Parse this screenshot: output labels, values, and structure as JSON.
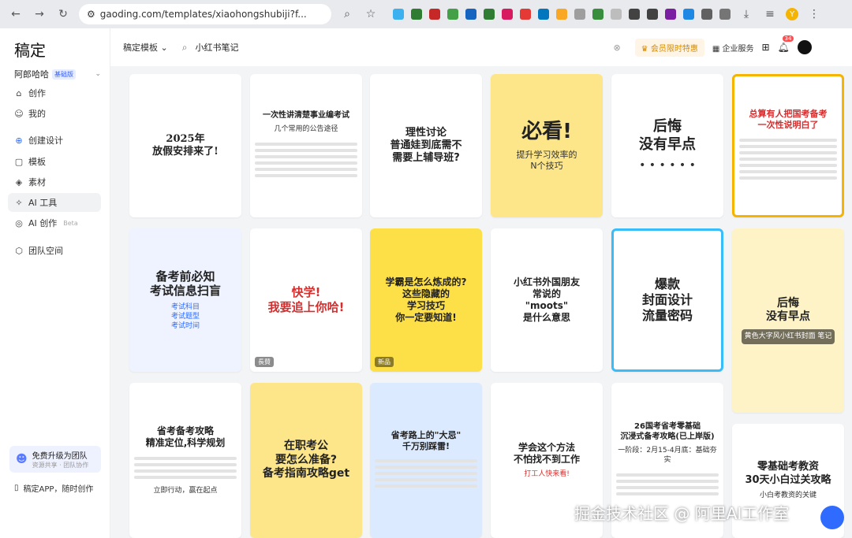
{
  "browser": {
    "url": "gaoding.com/templates/xiaohongshubiji?f...",
    "avatar_letter": "Y"
  },
  "sidebar": {
    "logo": "稿定",
    "user": "阿郎哈哈",
    "user_badge": "基础版",
    "items": [
      {
        "label": "创作",
        "icon": "home-icon"
      },
      {
        "label": "我的",
        "icon": "user-icon"
      },
      {
        "label": "创建设计",
        "icon": "plus-icon"
      },
      {
        "label": "模板",
        "icon": "template-icon"
      },
      {
        "label": "素材",
        "icon": "asset-icon"
      },
      {
        "label": "AI 工具",
        "icon": "ai-icon"
      },
      {
        "label": "AI 创作",
        "icon": "ai-create-icon",
        "badge": "Beta"
      },
      {
        "label": "团队空间",
        "icon": "team-icon"
      }
    ],
    "upgrade_title": "免费升级为团队",
    "upgrade_sub": "资源共享 · 团队协作",
    "app_label": "稿定APP，随时创作"
  },
  "topbar": {
    "template_select": "稿定模板",
    "search_value": "小红书笔记",
    "vip_label": "会员限时特惠",
    "biz_label": "企业服务",
    "notif_count": "34"
  },
  "cards": [
    {
      "title": "2025年\n放假安排来了!",
      "sub": ""
    },
    {
      "title": "一次性讲清楚事业编考试",
      "sub": "几个常用的公告途径"
    },
    {
      "title": "理性讨论\n普通娃到底需不\n需要上辅导班?",
      "sub": ""
    },
    {
      "title": "必看!",
      "sub": "提升学习效率的\nN个技巧"
    },
    {
      "title": "后悔\n没有早点",
      "sub": "• • • • • •"
    },
    {
      "title": "总算有人把国考备考\n一次性说明白了",
      "sub": ""
    },
    {
      "title": "备考前必知\n考试信息扫盲",
      "sub": "考试科目\n考试题型\n考试时间"
    },
    {
      "title": "快学!\n我要追上你哈!",
      "sub": "",
      "tag": "長賛"
    },
    {
      "title": "学霸是怎么炼成的?\n这些隐藏的\n学习技巧\n你一定要知道!",
      "sub": "",
      "tag": "新品"
    },
    {
      "title": "小红书外国朋友\n常说的\n\"moots\"\n是什么意思",
      "sub": ""
    },
    {
      "title": "爆款\n封面设计\n流量密码",
      "sub": ""
    },
    {
      "title": "后悔\n没有早点",
      "sub": "黄色大字风小红书封面 笔记"
    },
    {
      "title": "省考备考攻略\n精准定位,科学规划",
      "sub": "立即行动，赢在起点"
    },
    {
      "title": "在职考公\n要怎么准备?\n备考指南攻略get",
      "sub": ""
    },
    {
      "title": "省考路上的\"大忌\"\n千万别踩雷!",
      "sub": ""
    },
    {
      "title": "学会这个方法\n不怕找不到工作",
      "sub": "打工人快来看!"
    },
    {
      "title": "26国考省考零基础\n沉浸式备考攻略(已上岸版)",
      "sub": "一阶段：2月15-4月底：基础夯实"
    },
    {
      "title": "零基础考教资\n30天小白过关攻略",
      "sub": "小白考教资的关键"
    }
  ],
  "watermark": "掘金技术社区 @ 阿里AI工作室",
  "colors": {
    "accent": "#2f6bff",
    "vip": "#d68a00",
    "badge_red": "#ff4d4f"
  }
}
